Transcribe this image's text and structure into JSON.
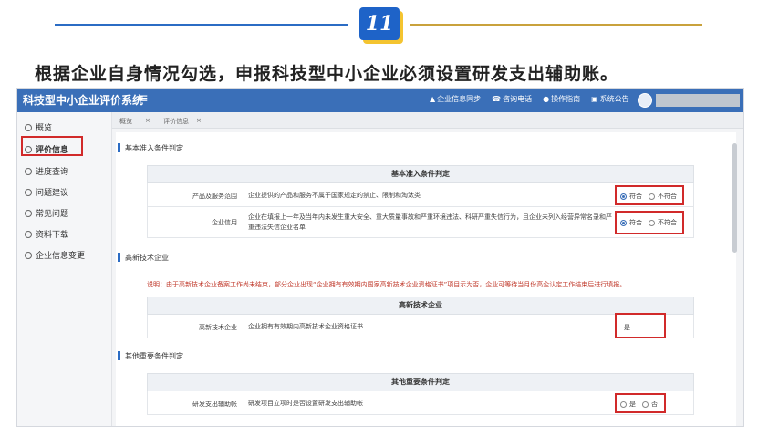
{
  "step_badge": "11",
  "headline": "根据企业自身情况勾选，申报科技型中小企业必须设置研发支出辅助账。",
  "app": {
    "title": "科技型中小企业评价系统",
    "nav": [
      {
        "label": "企业信息同步",
        "icon": "triangle-icon"
      },
      {
        "label": "咨询电话",
        "icon": "phone-icon"
      },
      {
        "label": "操作指南",
        "icon": "guide-icon"
      },
      {
        "label": "系统公告",
        "icon": "notice-icon"
      }
    ]
  },
  "sidebar": {
    "items": [
      {
        "label": "概览"
      },
      {
        "label": "评价信息"
      },
      {
        "label": "进度查询"
      },
      {
        "label": "问题建议"
      },
      {
        "label": "常见问题"
      },
      {
        "label": "资料下载"
      },
      {
        "label": "企业信息变更"
      }
    ]
  },
  "tabs": [
    {
      "label": "概览"
    },
    {
      "label": "评价信息"
    }
  ],
  "sections": {
    "basic": {
      "title": "基本准入条件判定",
      "table_header": "基本准入条件判定",
      "rows": [
        {
          "label": "产品及服务范围",
          "text": "企业提供的产品和服务不属于国家规定的禁止、限制和淘汰类",
          "opt_yes": "符合",
          "opt_no": "不符合"
        },
        {
          "label": "企业信用",
          "text": "企业在填报上一年及当年内未发生重大安全、重大质量事故和严重环境违法、科研严重失信行为，且企业未列入经营异常名录和严重违法失信企业名单",
          "opt_yes": "符合",
          "opt_no": "不符合"
        }
      ]
    },
    "hightech": {
      "title": "高新技术企业",
      "notice": "说明：由于高新技术企业备案工作尚未结束，部分企业出现“企业拥有有效期内国家高新技术企业资格证书”项目示为否，企业可等待当月份高企认定工作结束后进行填报。",
      "table_header": "高新技术企业",
      "row": {
        "label": "高新技术企业",
        "text": "企业拥有有效期内高新技术企业资格证书",
        "value": "是"
      }
    },
    "other": {
      "title": "其他重要条件判定",
      "table_header": "其他重要条件判定",
      "row": {
        "label": "研发支出辅助帐",
        "text": "研发项目立项时是否设置研发支出辅助帐",
        "opt_yes": "是",
        "opt_no": "否"
      }
    }
  },
  "colors": {
    "brand": "#3a6fb8",
    "highlight": "#d12a2a",
    "badge": "#1e63c8",
    "badge_shadow": "#f4c430"
  }
}
